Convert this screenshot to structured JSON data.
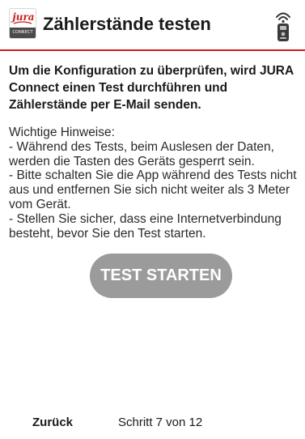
{
  "header": {
    "title": "Zählerstände testen",
    "logo": {
      "brand_text": "jura",
      "sub_text": "CONNECT"
    },
    "status_icon": "remote-signal-icon"
  },
  "main": {
    "intro": "Um die Konfiguration zu überprüfen, wird JURA Connect einen Test durchführen und Zählerstände per E-Mail senden.",
    "notes_heading": "Wichtige Hinweise:",
    "notes": [
      "- Während des Tests, beim Auslesen der Daten, werden die Tasten des Geräts gesperrt sein.",
      "- Bitte schalten Sie die App während des Tests nicht aus und entfernen Sie sich nicht weiter als 3 Meter vom Gerät.",
      "- Stellen Sie sicher, dass eine Internetverbindung besteht, bevor Sie den Test starten."
    ],
    "test_button_label": "TEST STARTEN"
  },
  "footer": {
    "back_label": "Zurück",
    "step_text": "Schritt 7 von 12"
  },
  "colors": {
    "accent": "#c81e1e",
    "button": "#9b9b9b",
    "button_text": "#ffffff",
    "text": "#1a1a1a"
  }
}
